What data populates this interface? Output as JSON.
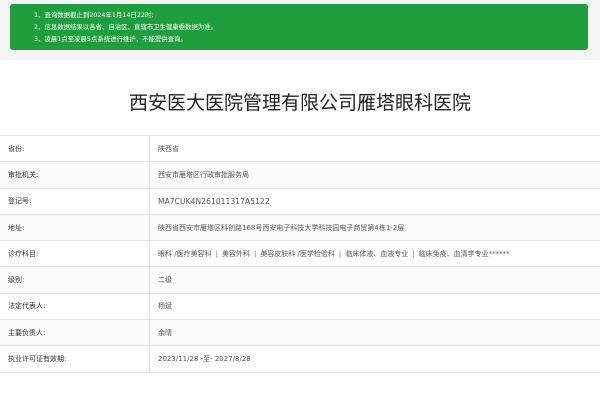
{
  "notice": {
    "lines": [
      "1、查询数据截止到2024年1月14日22时;",
      "2、信息数据结果以各省、自治区、直辖市卫生健康委数据为准。",
      "3、凌晨1点至凌晨5点系统进行维护，不能提供查询。"
    ]
  },
  "hospital": {
    "name": "西安医大医院管理有限公司雁塔眼科医院"
  },
  "fields": [
    {
      "label": "省份:",
      "value": "陕西省"
    },
    {
      "label": "审批机关:",
      "value": "西安市雁塔区行政审批服务局"
    },
    {
      "label": "登记号:",
      "value": "MA7CUK4N261011317A5122"
    },
    {
      "label": "地址:",
      "value": "陕西省西安市雁塔区科创路168号西安电子科技大学科技园电子商贸第4栋1-2层"
    },
    {
      "label": "诊疗科目:",
      "departments": [
        "眼科 /医疗美容科",
        "美容外科",
        "美容皮肤科 /医学检验科",
        "临床体液、血液专业",
        "临床免疫、血清学专业******"
      ]
    },
    {
      "label": "级别:",
      "value": "二级"
    },
    {
      "label": "法定代表人:",
      "value": "杨斌"
    },
    {
      "label": "主要负责人:",
      "value": "余晴"
    },
    {
      "label": "执业许可证有效期:",
      "value": "2023/11/28 -至- 2027/8/28"
    }
  ],
  "colors": {
    "notice_bg": "#1e9e3d",
    "border": "#e4e4e4"
  }
}
